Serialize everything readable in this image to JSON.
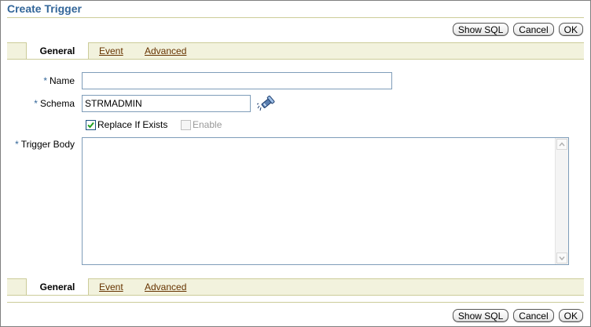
{
  "page": {
    "title": "Create Trigger"
  },
  "buttons": {
    "show_sql": "Show SQL",
    "cancel": "Cancel",
    "ok": "OK"
  },
  "tabs": {
    "general": "General",
    "event": "Event",
    "advanced": "Advanced",
    "active": "general"
  },
  "form": {
    "required_marker": "*",
    "name": {
      "label": "Name",
      "value": ""
    },
    "schema": {
      "label": "Schema",
      "value": "STRMADMIN",
      "search_icon": "flashlight-icon"
    },
    "replace_if_exists": {
      "label": "Replace If Exists",
      "checked": true
    },
    "enable": {
      "label": "Enable",
      "checked": false,
      "disabled": true
    },
    "trigger_body": {
      "label": "Trigger Body",
      "value": ""
    }
  },
  "colors": {
    "title": "#336699",
    "required_marker": "#336699",
    "tab_bar": "#f2f2dd",
    "tab_border": "#cccc99",
    "link": "#663300",
    "disabled_text": "#999999"
  }
}
